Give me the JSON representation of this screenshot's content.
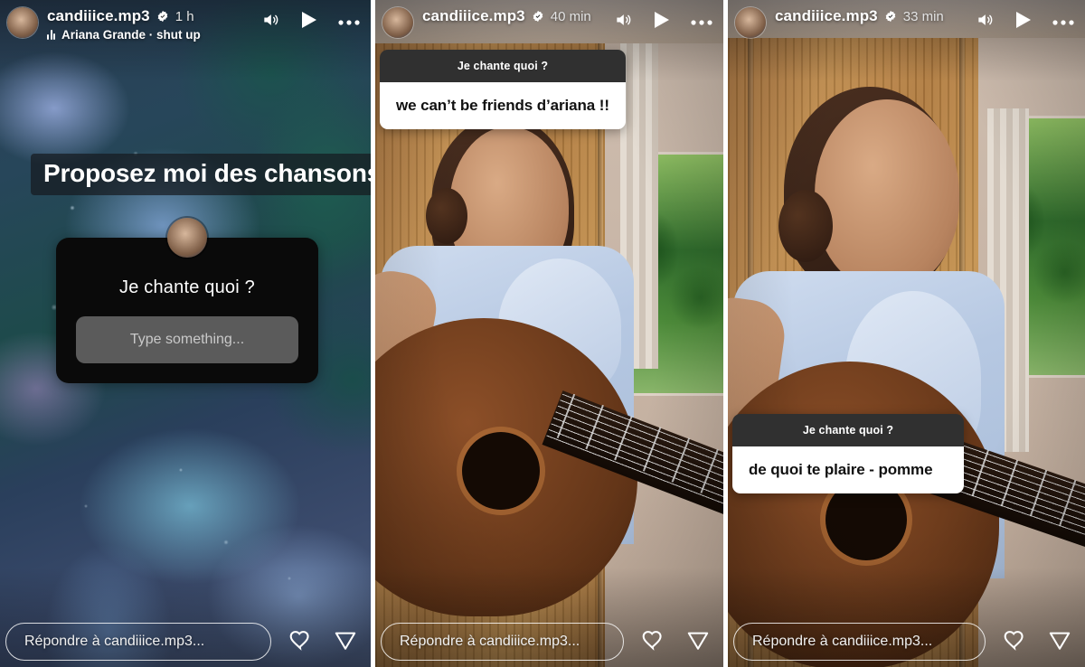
{
  "panels": [
    {
      "id": "story-panel-1",
      "header": {
        "username": "candiiice.mp3",
        "verified_icon": "verified-badge-icon",
        "timestamp": "1 h",
        "music_icon": "audio-equalizer-icon",
        "music_label": "Ariana Grande · shut up",
        "icons": [
          "speaker-icon",
          "play-icon",
          "more-options-icon"
        ]
      },
      "caption": "Proposez moi des chansons:)",
      "question_sticker": {
        "avatar": "question-sticker-avatar",
        "title": "Je chante quoi ?",
        "input_placeholder": "Type something..."
      },
      "footer": {
        "reply_placeholder": "Répondre à candiiice.mp3...",
        "icons": [
          "heart-icon",
          "share-icon"
        ]
      }
    },
    {
      "id": "story-panel-2",
      "header": {
        "username": "candiiice.mp3",
        "verified_icon": "verified-badge-icon",
        "timestamp": "40 min",
        "icons": [
          "speaker-icon",
          "play-icon",
          "more-options-icon"
        ]
      },
      "response_sticker": {
        "question": "Je chante quoi ?",
        "answer": "we can’t be friends d’ariana !!"
      },
      "footer": {
        "reply_placeholder": "Répondre à candiiice.mp3...",
        "icons": [
          "heart-icon",
          "share-icon"
        ]
      }
    },
    {
      "id": "story-panel-3",
      "header": {
        "username": "candiiice.mp3",
        "verified_icon": "verified-badge-icon",
        "timestamp": "33 min",
        "icons": [
          "speaker-icon",
          "play-icon",
          "more-options-icon"
        ]
      },
      "response_sticker": {
        "question": "Je chante quoi ?",
        "answer": "de quoi te plaire - pomme"
      },
      "footer": {
        "reply_placeholder": "Répondre à candiiice.mp3...",
        "icons": [
          "heart-icon",
          "share-icon"
        ]
      }
    }
  ],
  "colors": {
    "sticker_dark": "#303030",
    "sticker_light": "#ffffff",
    "question_card": "#0a0a0a",
    "question_input": "#5b5b5b",
    "text_light": "#ffffff",
    "verified_blue": "#ffffff"
  }
}
